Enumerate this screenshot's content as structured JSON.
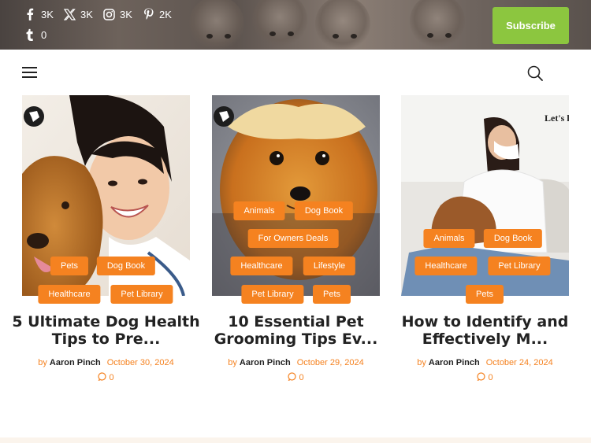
{
  "header": {
    "social": [
      {
        "icon": "facebook-icon",
        "count": "3K"
      },
      {
        "icon": "x-twitter-icon",
        "count": "3K"
      },
      {
        "icon": "instagram-icon",
        "count": "3K"
      },
      {
        "icon": "pinterest-icon",
        "count": "2K"
      },
      {
        "icon": "tumblr-icon",
        "count": "0"
      }
    ],
    "subscribe_label": "Subscribe"
  },
  "colors": {
    "accent": "#f58220",
    "subscribe": "#8cc63f"
  },
  "posts": [
    {
      "tags": [
        "Pets",
        "Dog Book",
        "Healthcare",
        "Pet Library"
      ],
      "title_line1": "5 Ultimate Dog Health",
      "title_line2": "Tips to Pre...",
      "by": "by",
      "author": "Aaron Pinch",
      "date": "October 30, 2024",
      "comments": "0"
    },
    {
      "tags": [
        "Animals",
        "Dog Book",
        "For Owners Deals",
        "Healthcare",
        "Lifestyle",
        "Pet Library",
        "Pets"
      ],
      "title_line1": "10 Essential Pet",
      "title_line2": "Grooming Tips Ev...",
      "by": "by",
      "author": "Aaron Pinch",
      "date": "October 29, 2024",
      "comments": "0"
    },
    {
      "tags": [
        "Animals",
        "Dog Book",
        "Healthcare",
        "Pet Library",
        "Pets"
      ],
      "title_line1": "How to Identify and",
      "title_line2": "Effectively M...",
      "by": "by",
      "author": "Aaron Pinch",
      "date": "October 24, 2024",
      "comments": "0",
      "image_text": "Let's l"
    }
  ]
}
